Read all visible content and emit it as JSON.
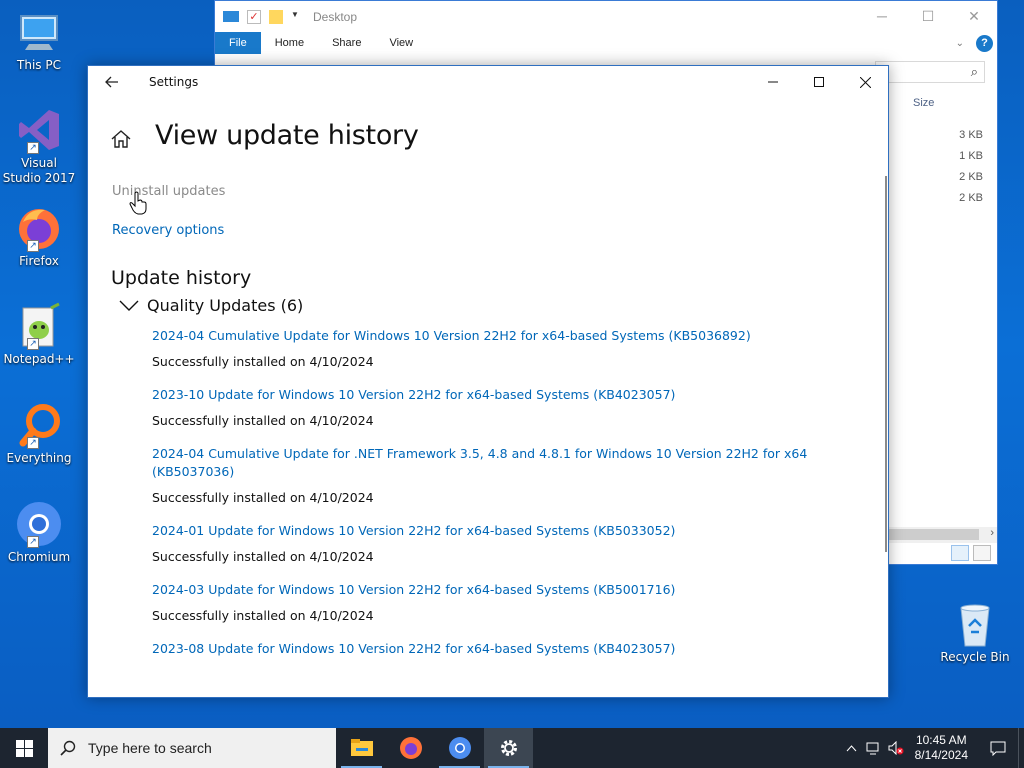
{
  "desktop": {
    "icons": [
      {
        "label": "This PC"
      },
      {
        "label": "Visual Studio 2017"
      },
      {
        "label": "Firefox"
      },
      {
        "label": "Notepad++"
      },
      {
        "label": "Everything"
      },
      {
        "label": "Chromium"
      },
      {
        "label": "Recycle Bin"
      }
    ]
  },
  "explorer": {
    "title": "Desktop",
    "tabs": [
      "File",
      "Home",
      "Share",
      "View"
    ],
    "column_header": "Size",
    "sizes": [
      "3 KB",
      "1 KB",
      "2 KB",
      "2 KB"
    ]
  },
  "settings": {
    "window_title": "Settings",
    "page_title": "View update history",
    "uninstall_link": "Uninstall updates",
    "recovery_link": "Recovery options",
    "section_title": "Update history",
    "group_label": "Quality Updates (6)",
    "updates": [
      {
        "name": "2024-04 Cumulative Update for Windows 10 Version 22H2 for x64-based Systems (KB5036892)",
        "status": "Successfully installed on 4/10/2024"
      },
      {
        "name": "2023-10 Update for Windows 10 Version 22H2 for x64-based Systems (KB4023057)",
        "status": "Successfully installed on 4/10/2024"
      },
      {
        "name": "2024-04 Cumulative Update for .NET Framework 3.5, 4.8 and 4.8.1 for Windows 10 Version 22H2 for x64 (KB5037036)",
        "status": "Successfully installed on 4/10/2024"
      },
      {
        "name": "2024-01 Update for Windows 10 Version 22H2 for x64-based Systems (KB5033052)",
        "status": "Successfully installed on 4/10/2024"
      },
      {
        "name": "2024-03 Update for Windows 10 Version 22H2 for x64-based Systems (KB5001716)",
        "status": "Successfully installed on 4/10/2024"
      },
      {
        "name": "2023-08 Update for Windows 10 Version 22H2 for x64-based Systems (KB4023057)",
        "status": ""
      }
    ]
  },
  "taskbar": {
    "search_placeholder": "Type here to search",
    "time": "10:45 AM",
    "date": "8/14/2024"
  },
  "colors": {
    "link": "#0067b8",
    "desktop": "#0b6fd6",
    "taskbar": "#1d2530"
  }
}
